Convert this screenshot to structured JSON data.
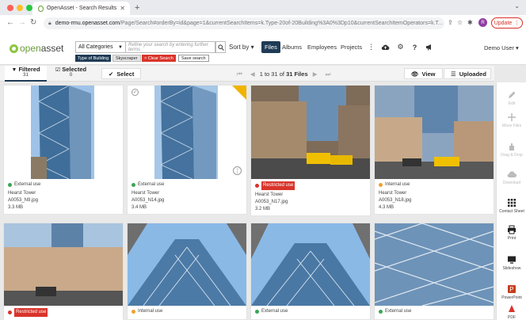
{
  "browser": {
    "tab_title": "OpenAsset - Search Results",
    "url_host": "demo-rmu.openasset.com",
    "url_path": "/Page/Search#orderBy=id&page=1&currentSearchItems=k.Type-20of-20Building%3A0%3Dp10&currentSearchItemOperators=k.T...",
    "profile_initial": "R",
    "update_label": "Update"
  },
  "header": {
    "logo_text_1": "open",
    "logo_text_2": "asset",
    "category_select": "All Categories",
    "search_placeholder": "Refine your search by entering further terms",
    "sort_label": "Sort by",
    "nav": [
      "Files",
      "Albums",
      "Employees",
      "Projects"
    ],
    "user_label": "Demo User",
    "chips": {
      "type": "Type of Building",
      "sky": "Skyscraper",
      "clear": "× Clear Search",
      "save": "Save search"
    }
  },
  "results_bar": {
    "filtered_label": "Filtered",
    "filtered_count": "31",
    "selected_label": "Selected",
    "selected_count": "0",
    "select_label": "Select",
    "pager_range": "1 to 31 of",
    "pager_total": "31 Files",
    "view_label": "View",
    "sort_uploaded": "Uploaded"
  },
  "cards": [
    {
      "usage": "External use",
      "usage_color": "#3aa655",
      "restricted": false,
      "project": "Hearst Tower",
      "filename": "A0053_N9.jpg",
      "size": "3.3 MB"
    },
    {
      "usage": "External use",
      "usage_color": "#3aa655",
      "restricted": false,
      "project": "Hearst Tower",
      "filename": "A0053_N14.jpg",
      "size": "3.4 MB"
    },
    {
      "usage": "Restricted use",
      "usage_color": "#d9342b",
      "restricted": true,
      "project": "Hearst Tower",
      "filename": "A0053_N17.jpg",
      "size": "3.2 MB"
    },
    {
      "usage": "Internal use",
      "usage_color": "#f0a030",
      "restricted": false,
      "project": "Hearst Tower",
      "filename": "A0053_N18.jpg",
      "size": "4.3 MB"
    },
    {
      "usage": "Restricted use",
      "usage_color": "#d9342b",
      "restricted": true
    },
    {
      "usage": "Internal use",
      "usage_color": "#f0a030",
      "restricted": false
    },
    {
      "usage": "External use",
      "usage_color": "#3aa655",
      "restricted": false
    },
    {
      "usage": "External use",
      "usage_color": "#3aa655",
      "restricted": false
    }
  ],
  "sidebar": {
    "edit": "Edit",
    "move": "Move Files",
    "drag": "Drag & Drop",
    "download": "Download",
    "contact": "Contact Sheet",
    "print": "Print",
    "slideshow": "Slideshow",
    "powerpoint": "PowerPoint",
    "pdf": "PDF"
  },
  "colors": {
    "brand_green": "#8dc63f",
    "navy": "#1f3b55",
    "danger": "#d9342b"
  }
}
